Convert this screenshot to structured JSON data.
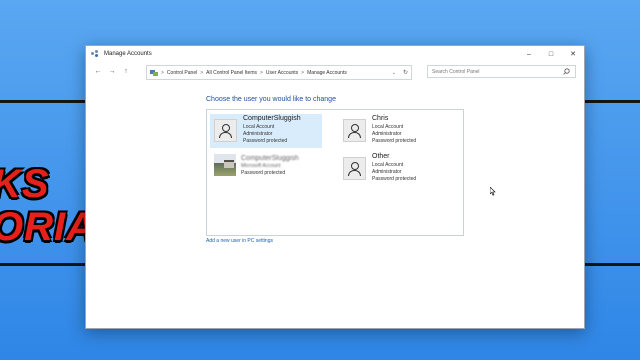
{
  "background": {
    "brand_line1": "KS",
    "brand_line2": "ORIALS",
    "accent": "#e8201b"
  },
  "window": {
    "title": "Manage Accounts",
    "controls": {
      "minimize": "–",
      "maximize": "□",
      "close": "✕"
    }
  },
  "navigation": {
    "back": "←",
    "forward": "→",
    "up": "↑",
    "breadcrumb": [
      "Control Panel",
      "All Control Panel Items",
      "User Accounts",
      "Manage Accounts"
    ],
    "separator": ">",
    "dropdown": "⌄",
    "refresh": "↻"
  },
  "search": {
    "placeholder": "Search Control Panel",
    "icon": "⌕"
  },
  "main": {
    "heading": "Choose the user you would like to change",
    "accounts": [
      {
        "name": "ComputerSluggish",
        "lines": [
          "Local Account",
          "Administrator",
          "Password protected"
        ]
      },
      {
        "name": "Chris",
        "lines": [
          "Local Account",
          "Administrator",
          "Password protected"
        ]
      },
      {
        "name": "ComputerSluggish",
        "lines": [
          "Microsoft Account",
          "Password protected"
        ]
      },
      {
        "name": "Other",
        "lines": [
          "Local Account",
          "Administrator",
          "Password protected"
        ]
      }
    ],
    "add_link": "Add a new user in PC settings"
  }
}
